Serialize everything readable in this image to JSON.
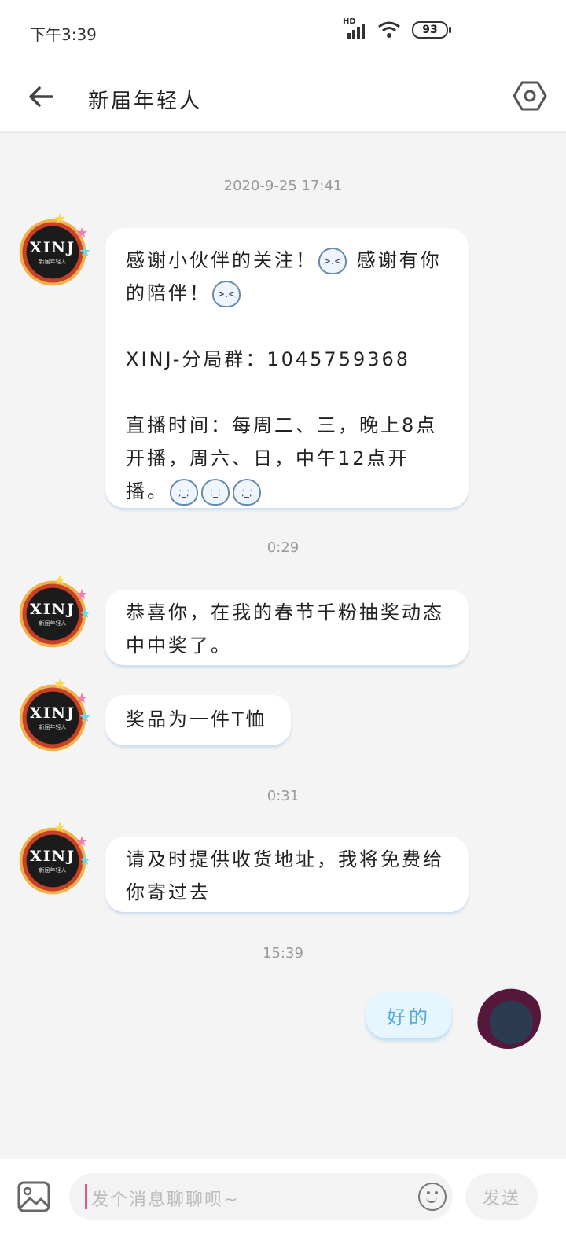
{
  "status_bar": {
    "time": "下午3:39",
    "hd": "HD",
    "battery": "93"
  },
  "header": {
    "title": "新届年轻人"
  },
  "avatar_text": {
    "logo": "XINJ",
    "sub": "新届年轻人"
  },
  "messages": {
    "ts1": "2020-9-25 17:41",
    "m1_line1": "感谢小伙伴的关注！",
    "m1_line1b": "感谢有你的陪伴！",
    "m1_line2": "XINJ-分局群：1045759368",
    "m1_line3": "直播时间：每周二、三，晚上8点开播，周六、日，中午12点开播。",
    "ts2": "0:29",
    "m2": "恭喜你，在我的春节千粉抽奖动态中中奖了。",
    "m3": "奖品为一件T恤",
    "ts3": "0:31",
    "m4": "请及时提供收货地址，我将免费给你寄过去",
    "ts4": "15:39",
    "my_reply": "好的"
  },
  "input_bar": {
    "placeholder": "发个消息聊聊呗~",
    "send_label": "发送"
  },
  "icons": [
    "back-arrow-icon",
    "settings-hexagon-icon",
    "image-icon",
    "emoji-smile-icon"
  ]
}
